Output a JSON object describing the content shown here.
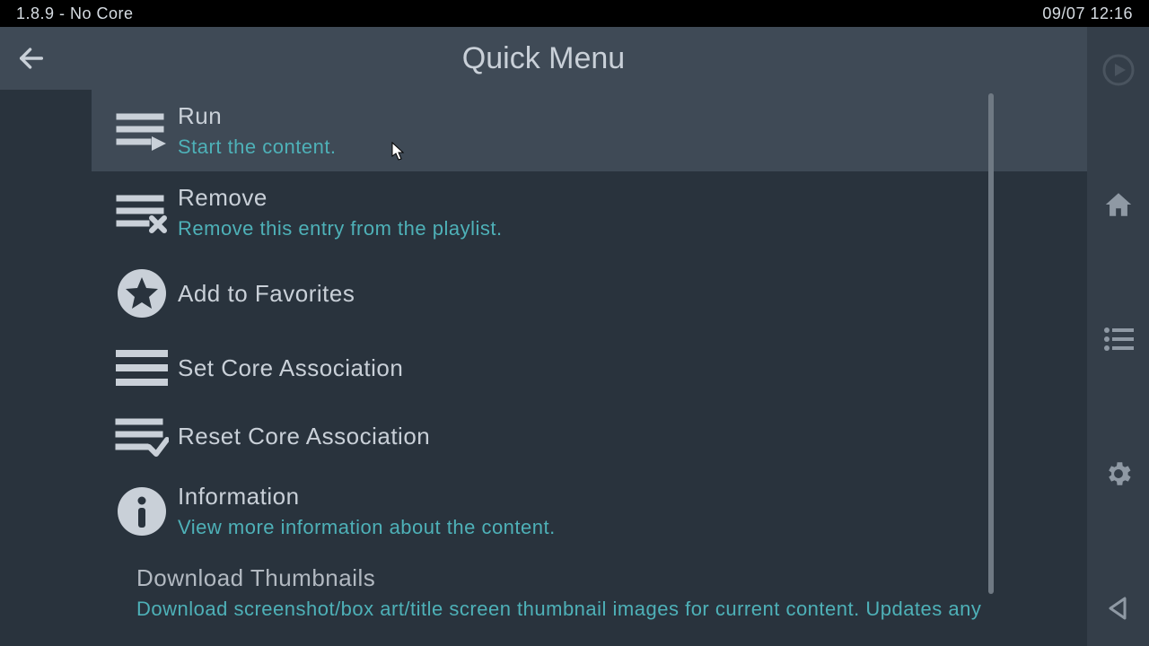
{
  "status": {
    "left": "1.8.9 - No Core",
    "right": "09/07 12:16"
  },
  "header": {
    "title": "Quick Menu"
  },
  "menu": [
    {
      "icon": "playlist-play",
      "title": "Run",
      "sub": "Start the content.",
      "hover": true
    },
    {
      "icon": "playlist-remove",
      "title": "Remove",
      "sub": "Remove this entry from the playlist."
    },
    {
      "icon": "star-circle",
      "title": "Add to Favorites"
    },
    {
      "icon": "lines",
      "title": "Set Core Association"
    },
    {
      "icon": "playlist-check",
      "title": "Reset Core Association"
    },
    {
      "icon": "info-circle",
      "title": "Information",
      "sub": "View more information about the content."
    },
    {
      "icon": "",
      "title": "Download Thumbnails",
      "sub": "Download screenshot/box art/title screen thumbnail images for current content. Updates any",
      "partial": true
    }
  ],
  "sidenav": [
    {
      "name": "resume-icon",
      "kind": "play-circle",
      "dim": true
    },
    {
      "name": "home-icon",
      "kind": "home"
    },
    {
      "name": "playlists-icon",
      "kind": "list"
    },
    {
      "name": "settings-icon",
      "kind": "gear"
    },
    {
      "name": "back-nav-icon",
      "kind": "triangle-left"
    }
  ]
}
